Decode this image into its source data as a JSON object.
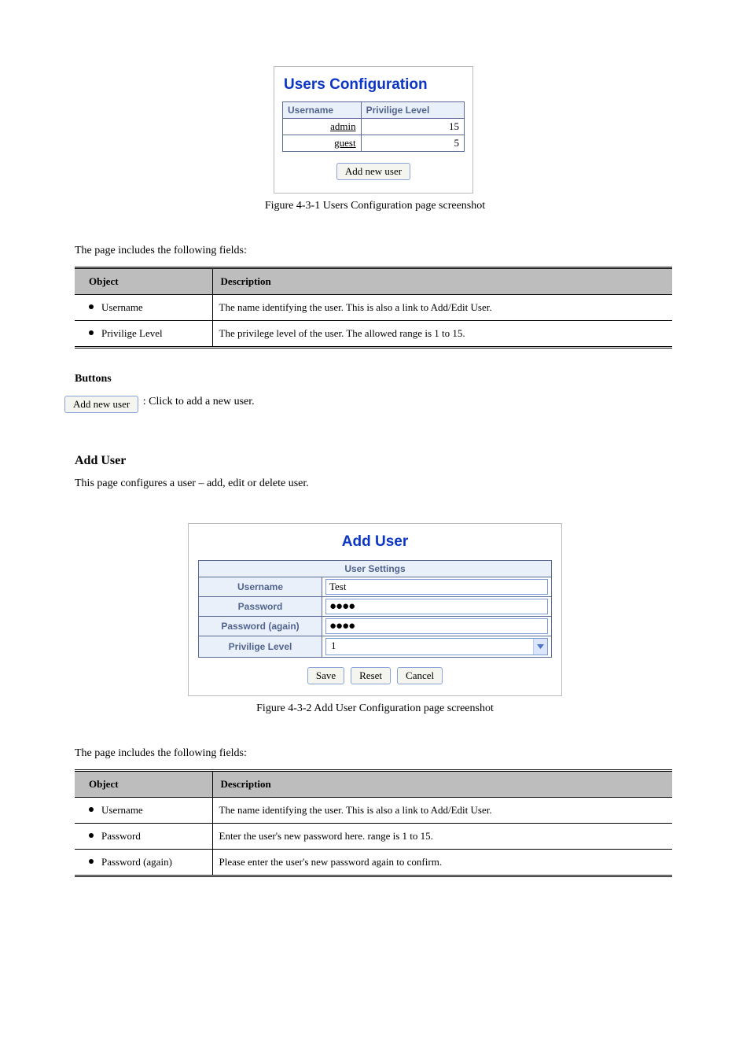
{
  "shot1": {
    "title": "Users Configuration",
    "colUsername": "Username",
    "colPrivLevel": "Privilige Level",
    "rows": [
      {
        "username": "admin",
        "level": "15"
      },
      {
        "username": "guest",
        "level": "5"
      }
    ],
    "addBtn": "Add new user"
  },
  "fig1Caption": "Figure 4-3-1 Users Configuration page screenshot",
  "tableIntro1": "The page includes the following fields:",
  "objTbl1": {
    "objectHdr": "Object",
    "descHdr": "Description",
    "rows": [
      {
        "obj": "Username",
        "desc": "The name identifying the user. This is also a link to Add/Edit User."
      },
      {
        "obj": "Privilige Level",
        "desc": "The privilege level of the user. The allowed range is 1 to 15."
      }
    ]
  },
  "buttonsHdr1": "Buttons",
  "addBtnExplain": "  : Click to add a new user.",
  "addUser": {
    "heading": "Add User",
    "intro": "This page configures a user – add, edit or delete user.",
    "title": "Add User",
    "sectionTitle": "User Settings",
    "lblUsername": "Username",
    "valUsername": "Test",
    "lblPassword": "Password",
    "valPasswordDots": "●●●●",
    "lblPasswordAgain": "Password (again)",
    "valPasswordAgainDots": "●●●●",
    "lblPrivLevel": "Privilige Level",
    "valPrivLevel": "1",
    "btnSave": "Save",
    "btnReset": "Reset",
    "btnCancel": "Cancel"
  },
  "fig2Caption": "Figure 4-3-2 Add User Configuration page screenshot",
  "tableIntro2": "The page includes the following fields:",
  "objTbl2": {
    "objectHdr": "Object",
    "descHdr": "Description",
    "rows": [
      {
        "obj": "Username",
        "desc": "The name identifying the user. This is also a link to Add/Edit User."
      },
      {
        "obj": "Password",
        "desc": "Enter the user's new password here. range is 1 to 15."
      },
      {
        "obj": "Password (again)",
        "desc": "Please enter the user's new password again to confirm."
      }
    ]
  }
}
